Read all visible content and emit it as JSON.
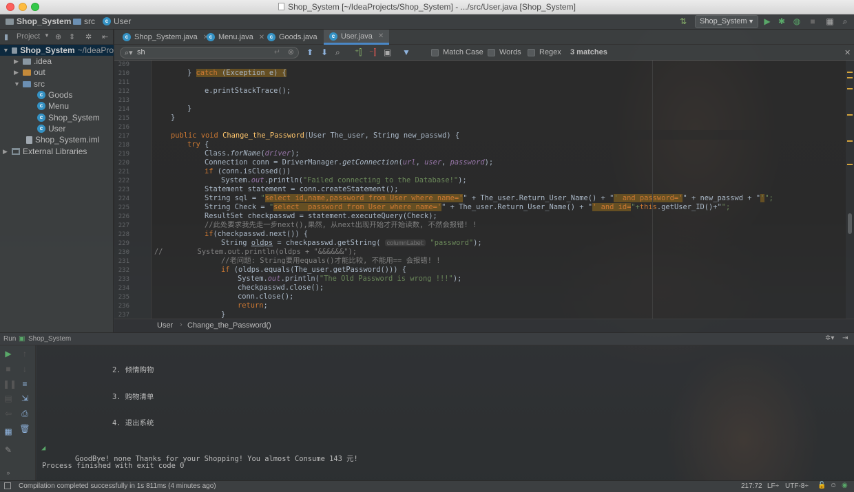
{
  "window": {
    "title": "Shop_System [~/IdeaProjects/Shop_System] - .../src/User.java [Shop_System]"
  },
  "navbar": {
    "project": "Shop_System",
    "folder": "src",
    "file": "User",
    "run_config": "Shop_System"
  },
  "project_panel": {
    "header": "Project",
    "tree": [
      {
        "label": "Shop_System",
        "extra": "~/IdeaPro",
        "type": "module"
      },
      {
        "label": ".idea",
        "type": "folder"
      },
      {
        "label": "out",
        "type": "folder-orange"
      },
      {
        "label": "src",
        "type": "folder-src"
      },
      {
        "label": "Goods",
        "type": "class"
      },
      {
        "label": "Menu",
        "type": "class"
      },
      {
        "label": "Shop_System",
        "type": "class"
      },
      {
        "label": "User",
        "type": "class"
      },
      {
        "label": "Shop_System.iml",
        "type": "iml"
      },
      {
        "label": "External Libraries",
        "type": "lib"
      }
    ]
  },
  "tabs": [
    {
      "label": "Shop_System.java",
      "active": false
    },
    {
      "label": "Menu.java",
      "active": false
    },
    {
      "label": "Goods.java",
      "active": false
    },
    {
      "label": "User.java",
      "active": true
    }
  ],
  "search": {
    "query": "sh",
    "match_case": "Match Case",
    "words": "Words",
    "regex": "Regex",
    "matches": "3 matches"
  },
  "line_numbers": [
    "209",
    "210",
    "211",
    "212",
    "213",
    "214",
    "215",
    "216",
    "217",
    "218",
    "219",
    "220",
    "221",
    "222",
    "223",
    "224",
    "225",
    "226",
    "227",
    "228",
    "229",
    "230",
    "231",
    "232",
    "233",
    "234",
    "235",
    "236",
    "237"
  ],
  "code": {
    "l209": [
      "} ",
      "catch",
      " (Exception e) {"
    ],
    "l211": "e.printStackTrace();",
    "l213": "}",
    "l215": "}",
    "l217": [
      "public void ",
      "Change_the_Password",
      "(User The_user, String new_passwd) {"
    ],
    "l218": [
      "try",
      " {"
    ],
    "l219": [
      "Class.",
      "forName",
      "(",
      "driver",
      ");"
    ],
    "l220": [
      "Connection conn = DriverManager.",
      "getConnection",
      "(",
      "url",
      ", ",
      "user",
      ", ",
      "password",
      ");"
    ],
    "l221": [
      "if",
      " (conn.isClosed())"
    ],
    "l222": [
      "System.",
      "out",
      ".println(",
      "\"Failed connecting to the Database!\"",
      ");"
    ],
    "l223": "Statement statement = conn.createStatement();",
    "l224": [
      "String sql = ",
      "\"",
      "select id,name,password ",
      "from User where name='",
      "\" + The_user.Return_User_Name() + \"",
      "'",
      " and password='",
      "\" + new_passwd + \"",
      "'",
      "\";"
    ],
    "l225": [
      "String Check = ",
      "\"",
      "select  password ",
      "from User where name='",
      "\" + The_user.Return_User_Name() + \"",
      "' and id=",
      "\"+",
      "this",
      ".getUser_ID()+\"",
      "\";"
    ],
    "l226": "ResultSet checkpasswd = statement.executeQuery(Check);",
    "l227": "//此处要求我先走一步next(),果然, 从next出现开始才开始读数, 不然会报错! !",
    "l228": [
      "if",
      "(checkpasswd.next()) {"
    ],
    "l229": [
      "String ",
      "oldps",
      " = checkpasswd.getString( ",
      "columnLabel:",
      " ",
      "\"password\"",
      ");"
    ],
    "l230": [
      "//",
      "        System.out.println(oldps + \"&&&&&&\");"
    ],
    "l231": "//老问题: String要用equals()才能比较, 不能用== 会报错! !",
    "l232": [
      "if",
      " (oldps.equals(The_user.getPassword())) {"
    ],
    "l233": [
      "System.",
      "out",
      ".println(",
      "\"The Old Password is wrong !!!\"",
      ");"
    ],
    "l234": "checkpasswd.close();",
    "l235": "conn.close();",
    "l236": [
      "return",
      ";"
    ],
    "l237": "}"
  },
  "breadcrumb": {
    "class": "User",
    "method": "Change_the_Password()"
  },
  "run": {
    "label": "Run",
    "config": "Shop_System",
    "output": [
      "2. 倾情购物",
      "3. 购物清单",
      "4. 退出系统",
      "GoodBye! none Thanks for your Shopping! You almost Consume 143 元!",
      "Process finished with exit code 0"
    ]
  },
  "status": {
    "message": "Compilation completed successfully in 1s 811ms (4 minutes ago)",
    "position": "217:72",
    "line_sep": "LF÷",
    "encoding": "UTF-8÷"
  },
  "colors": {
    "keyword": "#cc7832",
    "function": "#ffc66d",
    "string": "#6a8759",
    "comment": "#808080",
    "field": "#9876aa",
    "text": "#a9b7c6",
    "accent": "#4a88c7"
  }
}
